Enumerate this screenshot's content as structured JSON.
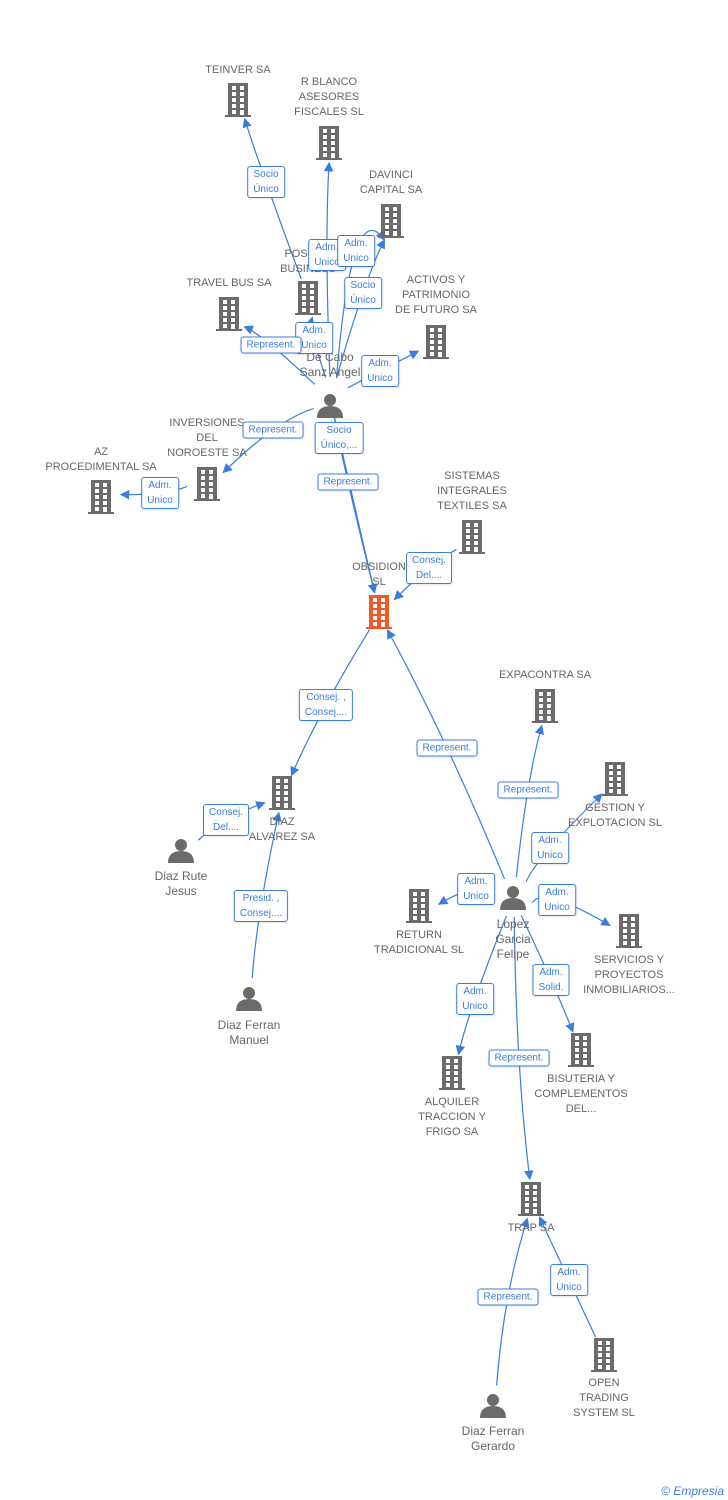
{
  "colors": {
    "company": "#6b6b6b",
    "focus": "#f05a28",
    "edge": "#3b7ddd"
  },
  "nodes": [
    {
      "type": "company",
      "lines": [
        "TEINVER SA"
      ]
    },
    {
      "type": "company",
      "lines": [
        "R BLANCO",
        "ASESORES",
        "FISCALES SL"
      ]
    },
    {
      "type": "company",
      "lines": [
        "DAVINCI",
        "CAPITAL SA"
      ]
    },
    {
      "type": "company",
      "lines": [
        "POSIBLE",
        "BUSINESS"
      ]
    },
    {
      "type": "company",
      "lines": [
        "TRAVEL BUS SA"
      ]
    },
    {
      "type": "company",
      "lines": [
        "ACTIVOS Y",
        "PATRIMONIO",
        "DE FUTURO SA"
      ]
    },
    {
      "type": "person",
      "lines": [
        "De Cabo",
        "Sanz Angel"
      ]
    },
    {
      "type": "company",
      "lines": [
        "INVERSIONES",
        "DEL",
        "NOROESTE SA"
      ]
    },
    {
      "type": "company",
      "lines": [
        "AZ",
        "PROCEDIMENTAL SA"
      ]
    },
    {
      "type": "company",
      "lines": [
        "SISTEMAS",
        "INTEGRALES",
        "TEXTILES SA"
      ]
    },
    {
      "type": "focus",
      "lines": [
        "OBSIDION",
        "SL"
      ]
    },
    {
      "type": "company",
      "lines": [
        "EXPACONTRA SA"
      ]
    },
    {
      "type": "company",
      "lines": [
        "GESTION Y",
        "EXPLOTACION SL"
      ]
    },
    {
      "type": "company",
      "lines": [
        "DIAZ",
        "ALVAREZ SA"
      ]
    },
    {
      "type": "person",
      "lines": [
        "Diaz Rute",
        "Jesus"
      ]
    },
    {
      "type": "company",
      "lines": [
        "RETURN",
        "TRADICIONAL SL"
      ]
    },
    {
      "type": "person",
      "lines": [
        "Lopez",
        "Garcia",
        "Felipe"
      ]
    },
    {
      "type": "company",
      "lines": [
        "SERVICIOS Y",
        "PROYECTOS",
        "INMOBILIARIOS..."
      ]
    },
    {
      "type": "person",
      "lines": [
        "Diaz Ferran",
        "Manuel"
      ]
    },
    {
      "type": "company",
      "lines": [
        "ALQUILER",
        "TRACCION Y",
        "FRIGO SA"
      ]
    },
    {
      "type": "company",
      "lines": [
        "BISUTERIA Y",
        "COMPLEMENTOS",
        "DEL..."
      ]
    },
    {
      "type": "company",
      "lines": [
        "TRAP SA"
      ]
    },
    {
      "type": "company",
      "lines": [
        "OPEN",
        "TRADING",
        "SYSTEM SL"
      ]
    },
    {
      "type": "person",
      "lines": [
        "Diaz Ferran",
        "Gerardo"
      ]
    }
  ],
  "edges": [
    {
      "from": 3,
      "to": 0,
      "label": [
        "Socio",
        "Único"
      ]
    },
    {
      "from": 6,
      "to": 1,
      "label": [
        "Adm.",
        "Unico"
      ]
    },
    {
      "from": 6,
      "to": 2,
      "label": [
        "Adm.",
        "Unico"
      ]
    },
    {
      "from": 6,
      "to": 2,
      "label": [
        "Socio",
        "Único"
      ]
    },
    {
      "from": 6,
      "to": 3,
      "label": [
        "Adm.",
        "Unico"
      ]
    },
    {
      "from": 6,
      "to": 4,
      "label": [
        "Represent."
      ]
    },
    {
      "from": 6,
      "to": 5,
      "label": [
        "Adm.",
        "Unico"
      ]
    },
    {
      "from": 6,
      "to": 7,
      "label": [
        "Represent."
      ]
    },
    {
      "from": 7,
      "to": 8,
      "label": [
        "Adm.",
        "Unico"
      ]
    },
    {
      "from": 6,
      "to": 10,
      "label": [
        "Socio",
        "Único,..."
      ]
    },
    {
      "from": 6,
      "to": 10,
      "label": [
        "Represent."
      ]
    },
    {
      "from": 9,
      "to": 10,
      "label": [
        "Consej.",
        "Del...."
      ]
    },
    {
      "from": 10,
      "to": 13,
      "label": [
        "Consej. ,",
        "Consej...."
      ]
    },
    {
      "from": 16,
      "to": 10,
      "label": [
        "Represent."
      ]
    },
    {
      "from": 16,
      "to": 11,
      "label": [
        "Represent."
      ]
    },
    {
      "from": 16,
      "to": 12,
      "label": [
        "Adm.",
        "Unico"
      ]
    },
    {
      "from": 16,
      "to": 15,
      "label": [
        "Adm.",
        "Unico"
      ]
    },
    {
      "from": 16,
      "to": 17,
      "label": [
        "Adm.",
        "Unico"
      ]
    },
    {
      "from": 16,
      "to": 20,
      "label": [
        "Adm.",
        "Solid."
      ]
    },
    {
      "from": 16,
      "to": 19,
      "label": [
        "Adm.",
        "Unico"
      ]
    },
    {
      "from": 16,
      "to": 21,
      "label": [
        "Represent."
      ]
    },
    {
      "from": 14,
      "to": 13,
      "label": [
        "Consej.",
        "Del...."
      ]
    },
    {
      "from": 18,
      "to": 13,
      "label": [
        "Presid. ,",
        "Consej...."
      ]
    },
    {
      "from": 23,
      "to": 21,
      "label": [
        "Represent."
      ]
    },
    {
      "from": 22,
      "to": 21,
      "label": [
        "Adm.",
        "Unico"
      ]
    }
  ],
  "footer": {
    "copyright": "©",
    "brand": "Empresia"
  }
}
